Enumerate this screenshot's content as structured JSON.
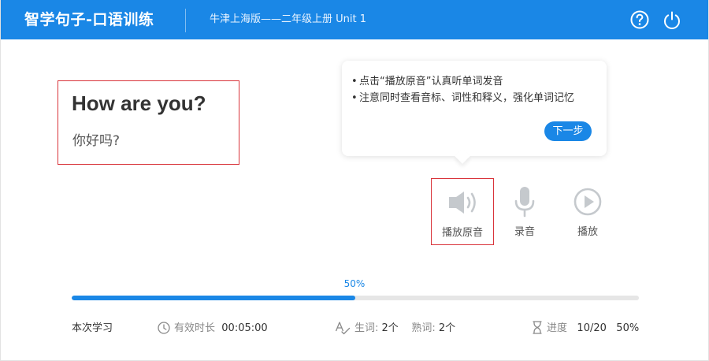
{
  "header": {
    "title": "智学句子-口语训练",
    "subtitle": "牛津上海版——二年级上册 Unit 1",
    "help_icon": "help-circle-icon",
    "power_icon": "power-icon",
    "color": "#1a87e6"
  },
  "sentence": {
    "english": "How are you?",
    "chinese": "你好吗?"
  },
  "tooltip": {
    "lines": [
      "点击“播放原音”认真听单词发音",
      "注意同时查看音标、词性和释义，强化单词记忆"
    ],
    "next_label": "下一步"
  },
  "actions": [
    {
      "label": "播放原音",
      "icon": "speaker-icon"
    },
    {
      "label": "录音",
      "icon": "microphone-icon"
    },
    {
      "label": "播放",
      "icon": "play-circle-icon"
    }
  ],
  "progress": {
    "percent_label": "50%",
    "value": 0.5
  },
  "stats": {
    "section_label": "本次学习",
    "duration_label": "有效时长",
    "duration_value": "00:05:00",
    "new_words_label": "生词:",
    "new_words_value": "2个",
    "known_words_label": "熟词:",
    "known_words_value": "2个",
    "progress_label": "进度",
    "progress_count": "10/20",
    "progress_percent": "50%"
  }
}
